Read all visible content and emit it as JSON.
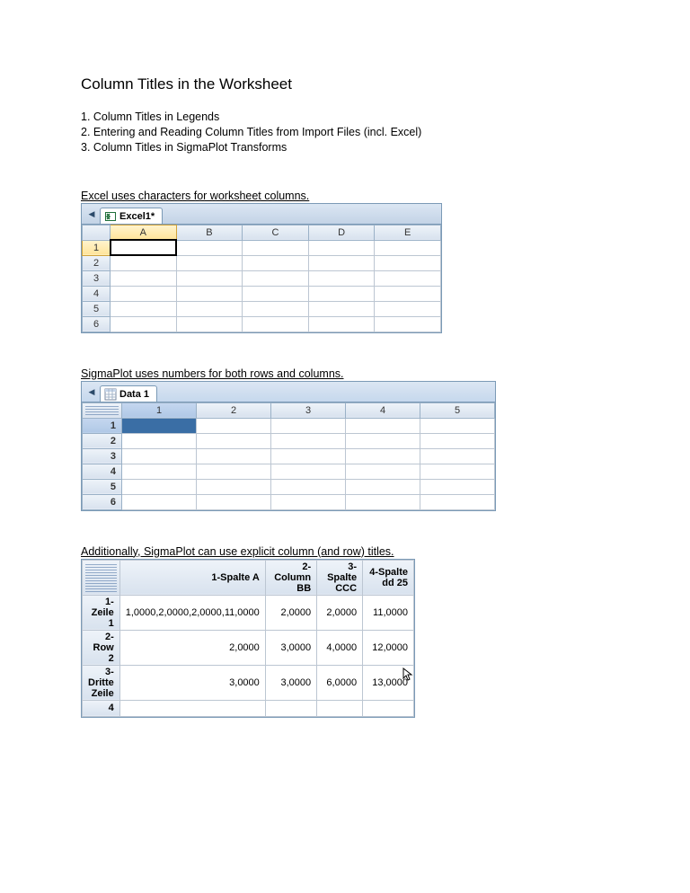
{
  "title": "Column Titles in the Worksheet",
  "toc": [
    "1. Column Titles in Legends",
    "2. Entering and Reading Column Titles from Import Files (incl. Excel)",
    "3. Column Titles in SigmaPlot Transforms"
  ],
  "caption1": "Excel uses characters for worksheet columns.",
  "excel": {
    "tab": "Excel1*",
    "cols": [
      "A",
      "B",
      "C",
      "D",
      "E"
    ],
    "rows": [
      "1",
      "2",
      "3",
      "4",
      "5",
      "6"
    ]
  },
  "caption2": "SigmaPlot uses numbers for both rows and columns.",
  "sigma": {
    "tab": "Data 1",
    "cols": [
      "1",
      "2",
      "3",
      "4",
      "5"
    ],
    "rows": [
      "1",
      "2",
      "3",
      "4",
      "5",
      "6"
    ]
  },
  "caption3": "Additionally, SigmaPlot can use explicit column (and row) titles.",
  "titled": {
    "cols": [
      "1-Spalte A",
      "2-Column BB",
      "3-Spalte CCC",
      "4-Spalte dd 25"
    ],
    "rows": [
      "1-Zeile 1",
      "2-Row 2",
      "3-Dritte Zeile",
      "4"
    ],
    "cells": [
      [
        "1,0000",
        "2,0000",
        "2,0000",
        "11,0000"
      ],
      [
        "2,0000",
        "3,0000",
        "4,0000",
        "12,0000"
      ],
      [
        "3,0000",
        "3,0000",
        "6,0000",
        "13,0000"
      ],
      [
        "",
        "",
        "",
        ""
      ]
    ]
  }
}
